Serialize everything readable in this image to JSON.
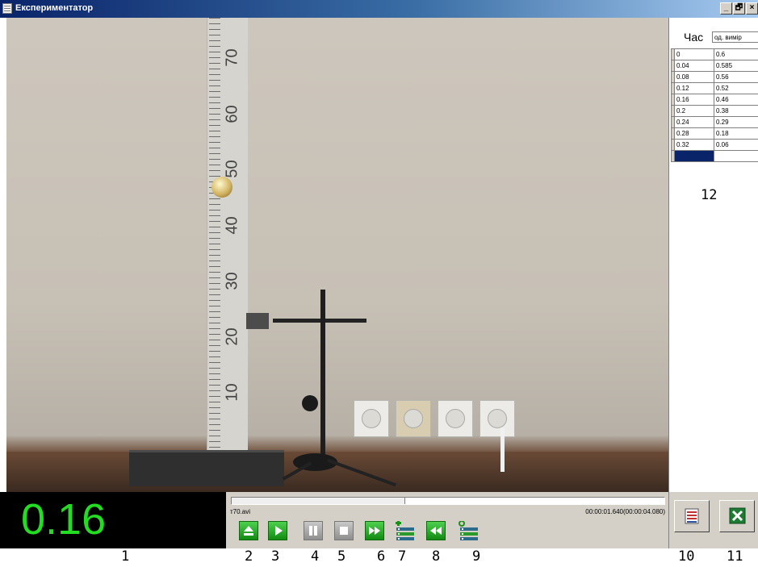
{
  "window": {
    "title": "Експериментатор",
    "controls": [
      "_",
      "🗗",
      "×"
    ]
  },
  "video": {
    "ruler_labels": [
      "70",
      "60",
      "50",
      "40",
      "30",
      "20",
      "10"
    ]
  },
  "display": {
    "value": "0.16",
    "color": "#22dd22"
  },
  "player": {
    "filename": "т70.avi",
    "time": "00:00:01.640(00:00:04.080)",
    "progress_fraction": 0.4,
    "buttons": [
      {
        "name": "eject-button",
        "icon": "eject-icon"
      },
      {
        "name": "play-button",
        "icon": "play-icon"
      },
      {
        "name": "pause-button",
        "icon": "pause-icon"
      },
      {
        "name": "stop-button",
        "icon": "stop-icon"
      },
      {
        "name": "step-forward-button",
        "icon": "fast-forward-icon"
      },
      {
        "name": "add-measurement-button",
        "icon": "list-add-icon"
      },
      {
        "name": "step-back-button",
        "icon": "rewind-icon"
      },
      {
        "name": "reset-measurement-button",
        "icon": "list-zero-icon"
      }
    ]
  },
  "table": {
    "time_header": "Час",
    "unit_field_value": "од. вимір",
    "rows": [
      [
        "0",
        "0.6"
      ],
      [
        "0.04",
        "0.585"
      ],
      [
        "0.08",
        "0.56"
      ],
      [
        "0.12",
        "0.52"
      ],
      [
        "0.16",
        "0.46"
      ],
      [
        "0.2",
        "0.38"
      ],
      [
        "0.24",
        "0.29"
      ],
      [
        "0.28",
        "0.18"
      ],
      [
        "0.32",
        "0.06"
      ],
      [
        "",
        ""
      ]
    ]
  },
  "side_buttons": [
    {
      "name": "table-settings-button",
      "icon": "table-icon"
    },
    {
      "name": "export-excel-button",
      "icon": "excel-icon"
    }
  ],
  "captions": {
    "c1": "1",
    "c2": "2",
    "c3": "3",
    "c4": "4",
    "c5": "5",
    "c6": "6",
    "c7": "7",
    "c8": "8",
    "c9": "9",
    "c10": "10",
    "c11": "11",
    "c12": "12"
  }
}
